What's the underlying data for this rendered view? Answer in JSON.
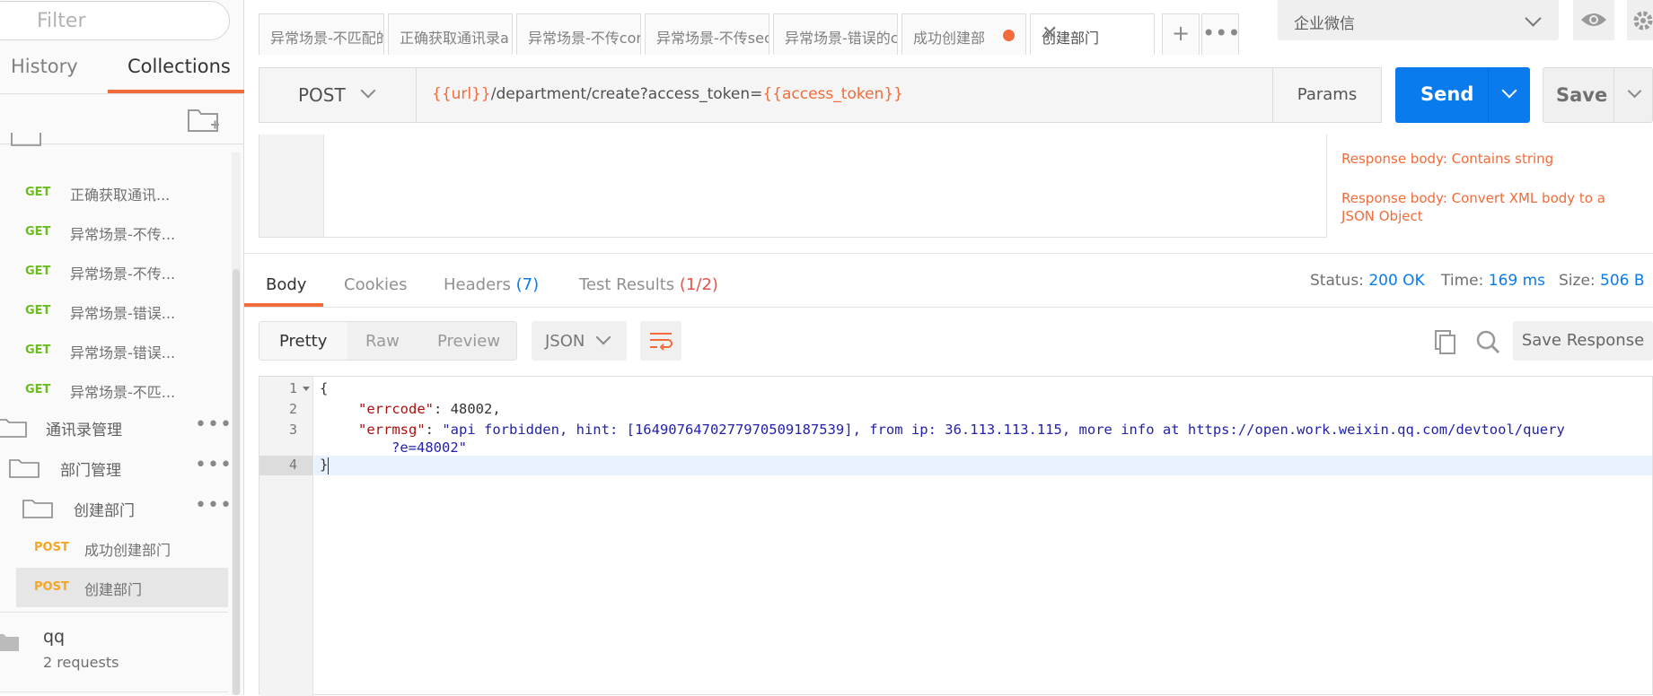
{
  "sidebar": {
    "filter_placeholder": "Filter",
    "tabs": {
      "history": "History",
      "collections": "Collections"
    },
    "requests": [
      {
        "method": "GET",
        "name": "正确获取通讯..."
      },
      {
        "method": "GET",
        "name": "异常场景-不传..."
      },
      {
        "method": "GET",
        "name": "异常场景-不传..."
      },
      {
        "method": "GET",
        "name": "异常场景-错误..."
      },
      {
        "method": "GET",
        "name": "异常场景-错误..."
      },
      {
        "method": "GET",
        "name": "异常场景-不匹..."
      }
    ],
    "folders": [
      {
        "name": "通讯录管理"
      },
      {
        "name": "部门管理"
      },
      {
        "name": "创建部门"
      }
    ],
    "folder_requests": [
      {
        "method": "POST",
        "name": "成功创建部门"
      },
      {
        "method": "POST",
        "name": "创建部门"
      }
    ],
    "collection": {
      "name": "qq",
      "sub": "2 requests"
    },
    "more_label": "•••"
  },
  "tabs": [
    {
      "label": "异常场景-不匹配的"
    },
    {
      "label": "正确获取通讯录a"
    },
    {
      "label": "异常场景-不传cor"
    },
    {
      "label": "异常场景-不传sec"
    },
    {
      "label": "异常场景-错误的c"
    },
    {
      "label": "成功创建部"
    },
    {
      "label": "创建部门"
    }
  ],
  "tab_add": "+",
  "tab_more": "•••",
  "tab_close": "✕",
  "environment": "企业微信",
  "request": {
    "method": "POST",
    "url_var1": "{{url}}",
    "url_path": "/department/create?access_token=",
    "url_var2": "{{access_token}}",
    "params_label": "Params",
    "send_label": "Send",
    "save_label": "Save"
  },
  "snippets": [
    "Response body: Contains string",
    "Response body: Convert XML body to a JSON Object"
  ],
  "response": {
    "tabs": {
      "body": "Body",
      "cookies": "Cookies",
      "headers": "Headers",
      "headers_count": "(7)",
      "tests": "Test Results",
      "tests_count": "(1/2)"
    },
    "status_label": "Status:",
    "status": "200 OK",
    "time_label": "Time:",
    "time": "169 ms",
    "size_label": "Size:",
    "size": "506 B",
    "formats": {
      "pretty": "Pretty",
      "raw": "Raw",
      "preview": "Preview"
    },
    "lang": "JSON",
    "save_response": "Save Response",
    "lines": [
      "1",
      "2",
      "3",
      "4"
    ],
    "code": {
      "open": "{",
      "errcode_key": "\"errcode\"",
      "errcode_val": "48002",
      "errmsg_key": "\"errmsg\"",
      "errmsg_val_1": "\"api forbidden, hint: [1649076470277970509187539], from ip: 36.113.113.115, more info at https://open.work.weixin.qq.com/devtool/query",
      "errmsg_val_2": "?e=48002\"",
      "close": "}"
    }
  },
  "colors": {
    "accent": "#f26b3a",
    "primary": "#097bed",
    "get": "#6bbd1e",
    "post": "#f5a623"
  }
}
